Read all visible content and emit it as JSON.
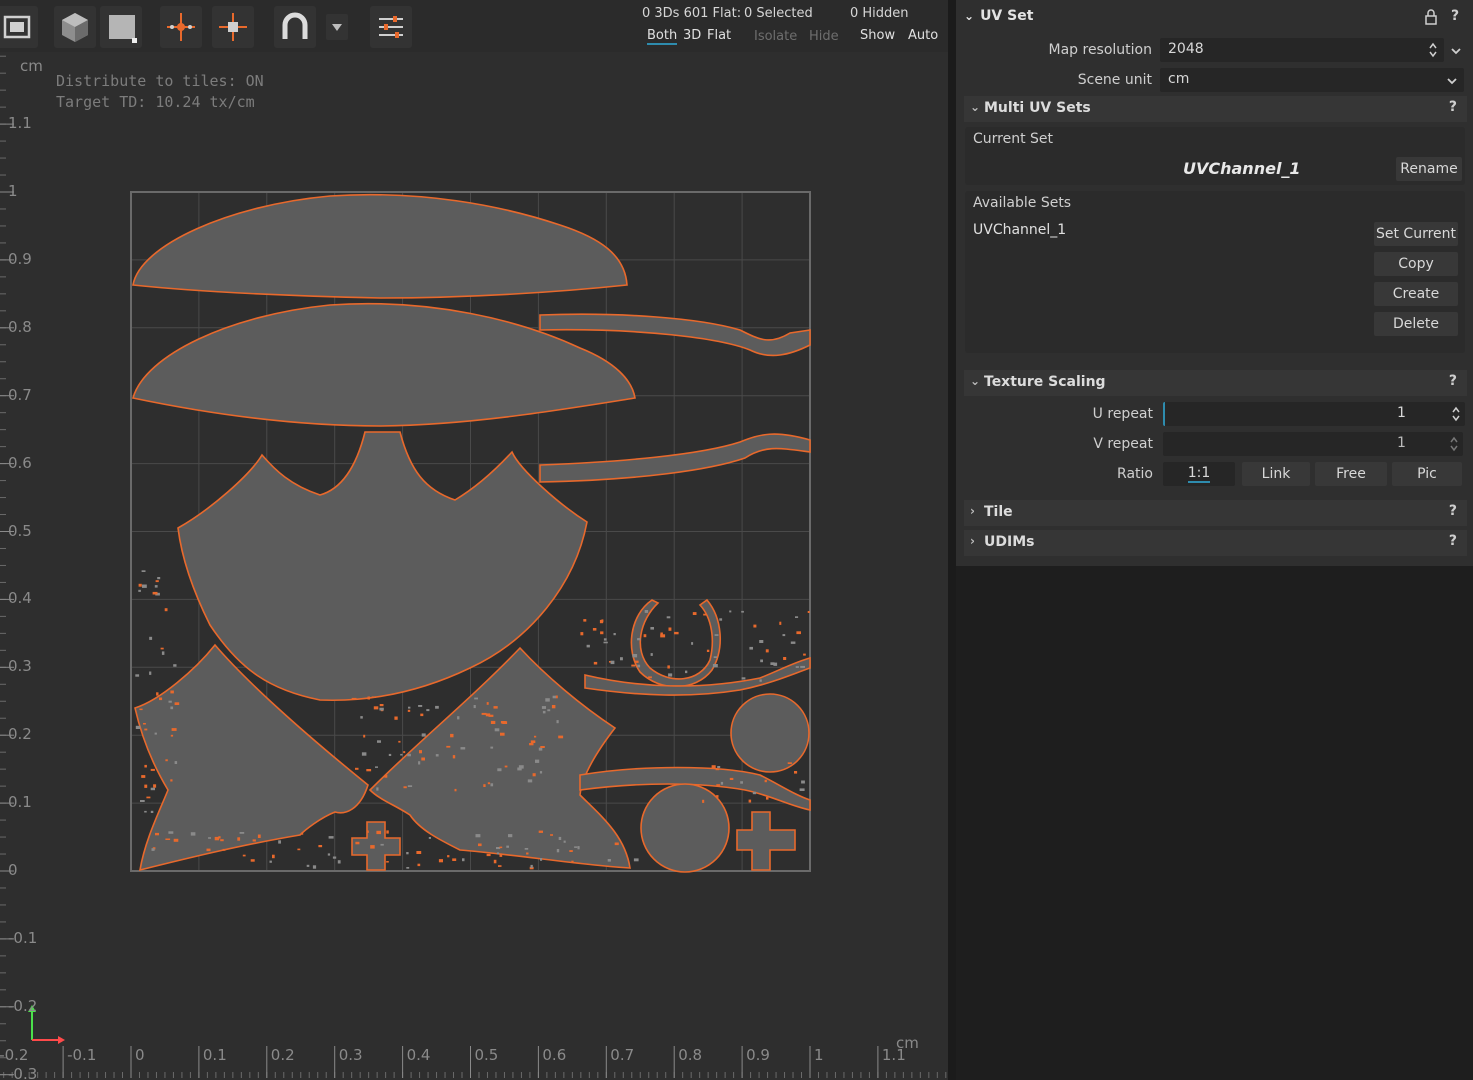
{
  "viewport": {
    "stats": {
      "count_3d": "0 3Ds 601 Flat:",
      "selected": "0 Selected",
      "hidden": "0 Hidden"
    },
    "view_modes": {
      "both": "Both",
      "three_d": "3D",
      "flat": "Flat"
    },
    "visibility": {
      "isolate": "Isolate",
      "hide": "Hide",
      "show": "Show",
      "auto": "Auto"
    },
    "info_lines": {
      "distribute": "Distribute to tiles: ON",
      "target_td": "Target TD: 10.24 tx/cm"
    },
    "ruler": {
      "unit": "cm",
      "y_labels": [
        "1.1",
        "1",
        "0.9",
        "0.8",
        "0.7",
        "0.6",
        "0.5",
        "0.4",
        "0.3",
        "0.2",
        "0.1",
        "0",
        "-0.1",
        "-0.2",
        "-0.3"
      ],
      "x_labels": [
        "-0.2",
        "-0.1",
        "0",
        "0.1",
        "0.2",
        "0.3",
        "0.4",
        "0.5",
        "0.6",
        "0.7",
        "0.8",
        "0.9",
        "1",
        "1.1"
      ]
    },
    "colors": {
      "seam": "#e8692c",
      "island": "#5c5c5c",
      "grid": "#4a4a4a",
      "background": "#2e2e2e"
    }
  },
  "panel": {
    "uv_set": {
      "title": "UV Set",
      "map_resolution_label": "Map resolution",
      "map_resolution_value": "2048",
      "scene_unit_label": "Scene unit",
      "scene_unit_value": "cm"
    },
    "multi_uv_sets": {
      "title": "Multi UV Sets",
      "help": "?",
      "current_set_label": "Current Set",
      "current_set_value": "UVChannel_1",
      "rename": "Rename",
      "available_sets_label": "Available Sets",
      "sets": [
        "UVChannel_1"
      ],
      "set_current": "Set Current",
      "copy": "Copy",
      "create": "Create",
      "delete": "Delete"
    },
    "texture_scaling": {
      "title": "Texture Scaling",
      "help": "?",
      "u_repeat_label": "U repeat",
      "u_repeat_value": "1",
      "v_repeat_label": "V repeat",
      "v_repeat_value": "1",
      "ratio_label": "Ratio",
      "ratio_options": [
        "1:1",
        "Link",
        "Free",
        "Pic"
      ],
      "ratio_selected": "1:1"
    },
    "tile": {
      "title": "Tile",
      "help": "?"
    },
    "udims": {
      "title": "UDIMs",
      "help": "?"
    },
    "header_help": "?"
  }
}
